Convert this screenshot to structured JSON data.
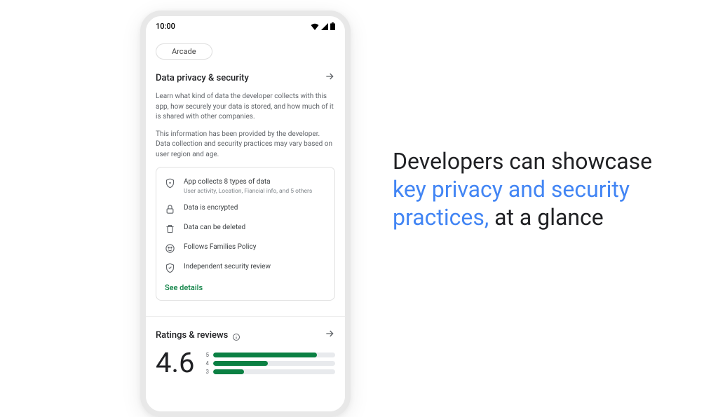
{
  "status_bar": {
    "time": "10:00"
  },
  "chip_label": "Arcade",
  "section": {
    "title": "Data privacy & security",
    "desc1": "Learn what kind of data the developer collects with this app, how securely your data is stored, and how much of it is shared with other companies.",
    "desc2": "This information has been provided by the developer. Data collection and security practices may vary based on user region and age."
  },
  "card": {
    "rows": [
      {
        "title": "App collects 8 types of data",
        "sub": "User activity, Location, Fiancial info, and 5 others"
      },
      {
        "title": "Data is encrypted",
        "sub": ""
      },
      {
        "title": "Data can be deleted",
        "sub": ""
      },
      {
        "title": "Follows Families Policy",
        "sub": ""
      },
      {
        "title": "Independent security review",
        "sub": ""
      }
    ],
    "see_details": "See details"
  },
  "ratings": {
    "title": "Ratings & reviews",
    "score": "4.6",
    "bars": [
      {
        "label": "5",
        "pct": 85
      },
      {
        "label": "4",
        "pct": 45
      },
      {
        "label": "3",
        "pct": 25
      }
    ]
  },
  "marketing": {
    "part1": "Developers can showcase ",
    "highlight": "key privacy and security practices,",
    "part2": " at a glance"
  },
  "colors": {
    "accent_green": "#0b8043",
    "highlight_blue": "#4285f4"
  }
}
